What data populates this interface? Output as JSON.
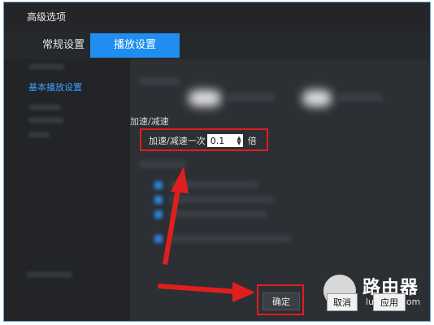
{
  "window": {
    "title": "高级选项"
  },
  "tabs": [
    {
      "label": "常规设置",
      "active": false
    },
    {
      "label": "播放设置",
      "active": true
    }
  ],
  "sidebar": {
    "active_item": "基本播放设置"
  },
  "speed": {
    "section_label": "加速/减速",
    "row_label": "加速/减速一次",
    "value": "0.1",
    "unit": "倍"
  },
  "buttons": {
    "ok": "确定",
    "cancel": "取消",
    "apply": "应用"
  },
  "watermark": {
    "text": "路由器",
    "url": "luyouqi.com"
  },
  "colors": {
    "accent": "#1f8ef0",
    "annotation": "#e01e1e"
  }
}
